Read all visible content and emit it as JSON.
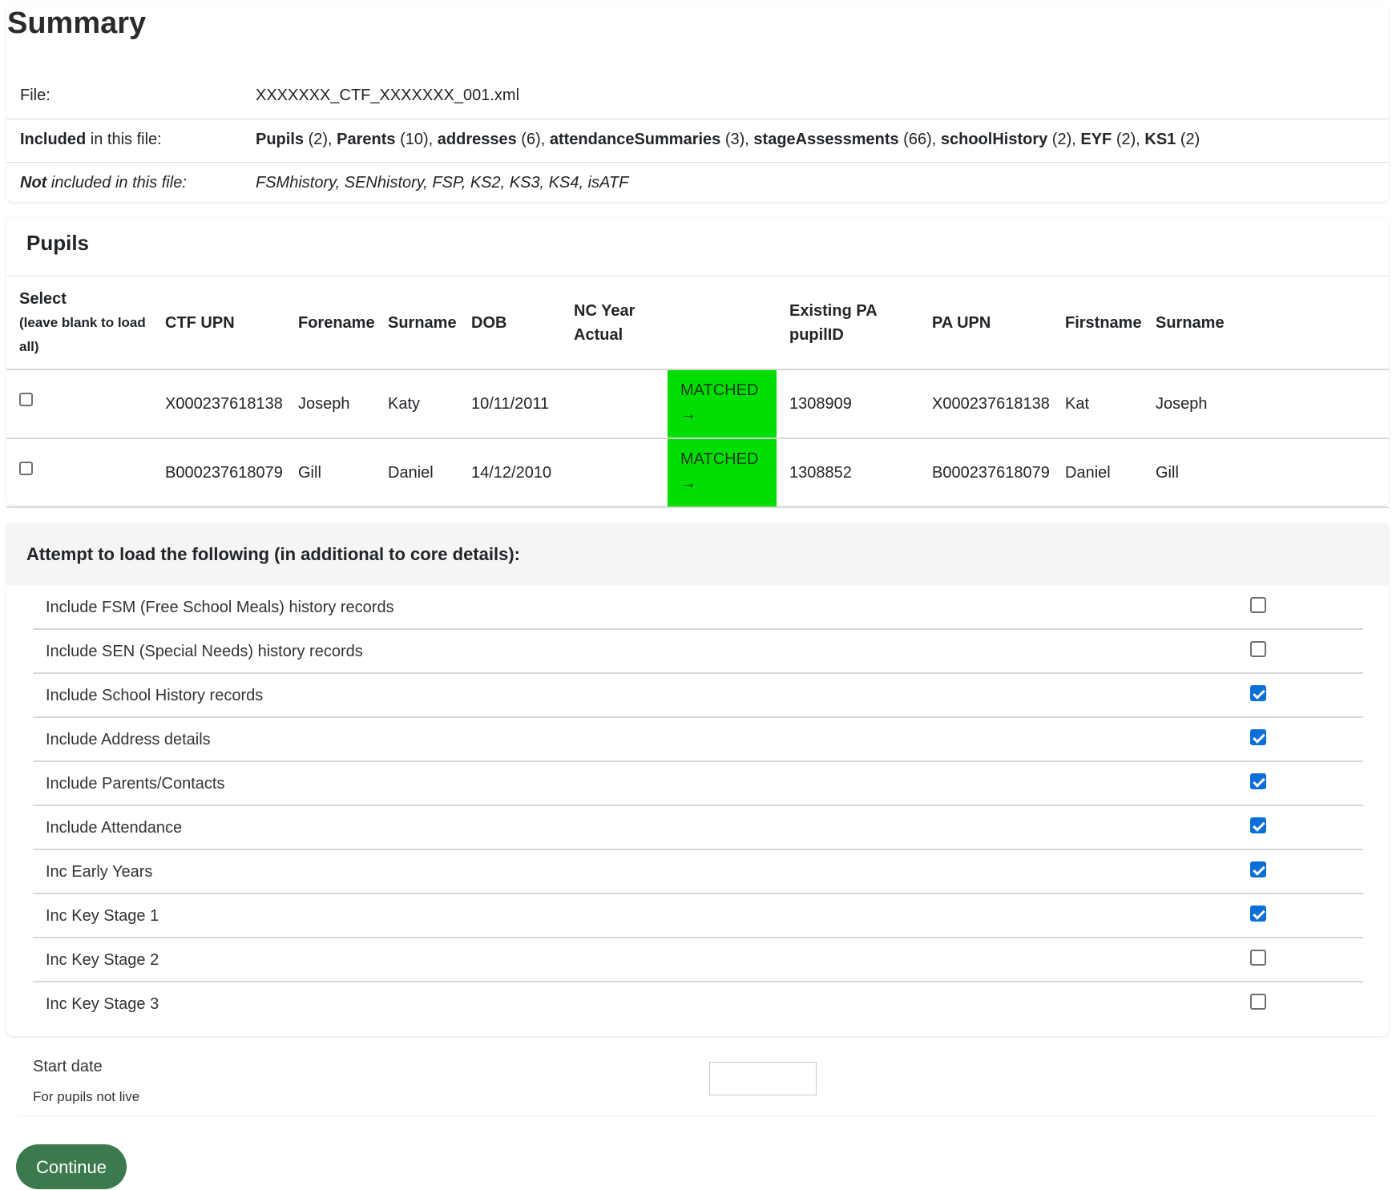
{
  "summary": {
    "title": "Summary",
    "file_label": "File:",
    "file_value": "XXXXXXX_CTF_XXXXXXX_001.xml",
    "included_label_bold": "Included",
    "included_label_rest": " in this file:",
    "included_items": [
      {
        "name": "Pupils",
        "count": " (2)"
      },
      {
        "name": "Parents",
        "count": " (10)"
      },
      {
        "name": "addresses",
        "count": " (6)"
      },
      {
        "name": "attendanceSummaries",
        "count": " (3)"
      },
      {
        "name": "stageAssessments",
        "count": " (66)"
      },
      {
        "name": "schoolHistory",
        "count": " (2)"
      },
      {
        "name": "EYF",
        "count": " (2)"
      },
      {
        "name": "KS1",
        "count": " (2)"
      }
    ],
    "not_included_label_bold": "Not",
    "not_included_label_rest": " included in this file:",
    "not_included_value": "FSMhistory, SENhistory, FSP, KS2, KS3, KS4, isATF"
  },
  "pupils": {
    "title": "Pupils",
    "headers": {
      "select": "Select",
      "select_sub": "(leave blank to load all)",
      "ctf_upn": "CTF UPN",
      "forename": "Forename",
      "surname": "Surname",
      "dob": "DOB",
      "nc_year": "NC Year Actual",
      "match": "",
      "existing_pa": "Existing PA pupilID",
      "pa_upn": "PA UPN",
      "firstname": "Firstname",
      "pa_surname": "Surname"
    },
    "rows": [
      {
        "ctf_upn": "X000237618138",
        "forename": "Joseph",
        "surname": "Katy",
        "dob": "10/11/2011",
        "nc_year": "",
        "status": "MATCHED",
        "arrow": "→",
        "existing_pa": "1308909",
        "pa_upn": "X000237618138",
        "firstname": "Kat",
        "pa_surname": "Joseph",
        "selected": false
      },
      {
        "ctf_upn": "B000237618079",
        "forename": "Gill",
        "surname": "Daniel",
        "dob": "14/12/2010",
        "nc_year": "",
        "status": "MATCHED",
        "arrow": "→",
        "existing_pa": "1308852",
        "pa_upn": "B000237618079",
        "firstname": "Daniel",
        "pa_surname": "Gill",
        "selected": false
      }
    ],
    "match_color": "#00dd00"
  },
  "options": {
    "title": "Attempt to load the following (in additional to core details):",
    "items": [
      {
        "label": "Include FSM (Free School Meals) history records",
        "checked": false
      },
      {
        "label": "Include SEN (Special Needs) history records",
        "checked": false
      },
      {
        "label": "Include School History records",
        "checked": true
      },
      {
        "label": "Include Address details",
        "checked": true
      },
      {
        "label": "Include Parents/Contacts",
        "checked": true
      },
      {
        "label": "Include Attendance",
        "checked": true
      },
      {
        "label": "Inc Early Years",
        "checked": true
      },
      {
        "label": "Inc Key Stage 1",
        "checked": true
      },
      {
        "label": "Inc Key Stage 2",
        "checked": false
      },
      {
        "label": "Inc Key Stage 3",
        "checked": false
      }
    ]
  },
  "start_date": {
    "label": "Start date",
    "help": "For pupils not live",
    "value": ""
  },
  "continue_label": "Continue",
  "colors": {
    "checkbox_checked": "#0b6fd8",
    "continue_button": "#3b7a4d"
  }
}
